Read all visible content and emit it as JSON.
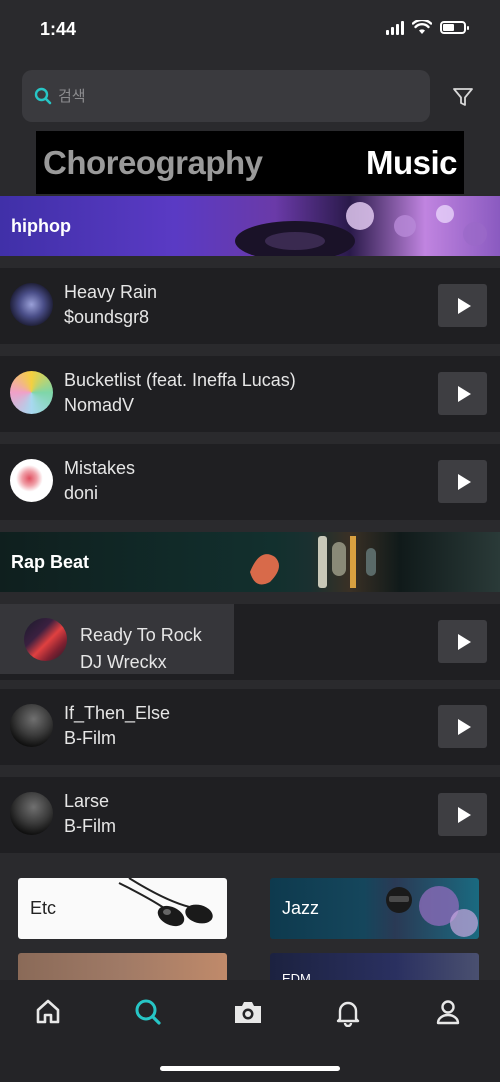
{
  "status_bar": {
    "time": "1:44"
  },
  "search": {
    "placeholder": "검색"
  },
  "tabs": {
    "choreography": "Choreography",
    "music": "Music"
  },
  "categories": [
    {
      "name": "hiphop",
      "tracks": [
        {
          "title": "Heavy Rain",
          "artist": "$oundsgr8"
        },
        {
          "title": "Bucketlist (feat. Ineffa Lucas)",
          "artist": "NomadV"
        },
        {
          "title": "Mistakes",
          "artist": "doni"
        }
      ]
    },
    {
      "name": "Rap Beat",
      "tracks": [
        {
          "title": "Ready To Rock",
          "artist": "DJ Wreckx"
        },
        {
          "title": "If_Then_Else",
          "artist": "B-Film"
        },
        {
          "title": "Larse",
          "artist": "B-Film"
        }
      ]
    }
  ],
  "genre_cards": [
    "Etc",
    "Jazz",
    "",
    "EDM"
  ],
  "tab_bar": [
    "home-icon",
    "search-icon",
    "camera-icon",
    "bell-icon",
    "profile-icon"
  ],
  "colors": {
    "accent": "#27c6c6",
    "background": "#2a2a2d",
    "row": "#1f1f22"
  }
}
